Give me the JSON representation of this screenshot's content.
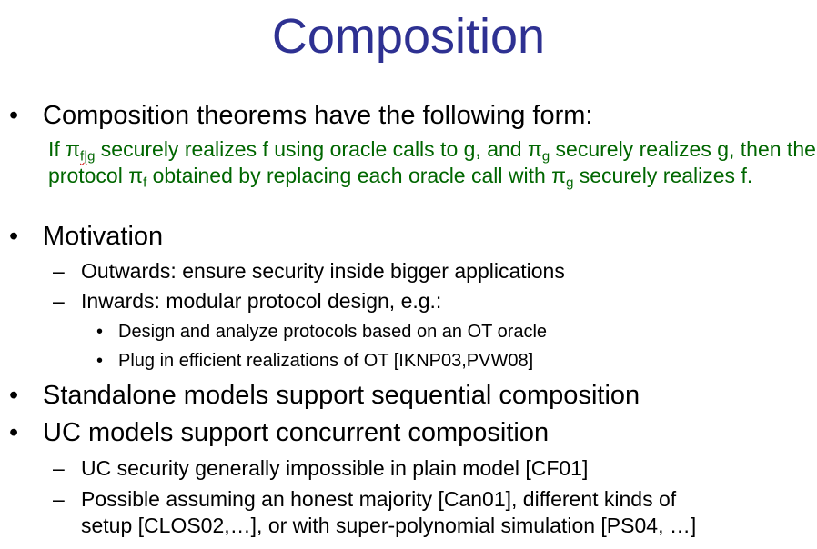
{
  "title": "Composition",
  "bullet1": "Composition theorems have the following form:",
  "theorem": {
    "p1": "If π",
    "s1": "f|g",
    "p2": " securely realizes f using oracle calls to g, and π",
    "s2": "g",
    "p3": " securely realizes g, then the protocol π",
    "s3": "f",
    "p4": " obtained by replacing each oracle call with π",
    "s4": "g",
    "p5": " securely realizes f."
  },
  "bullet2": "Motivation",
  "sub2": {
    "outwards": "Outwards: ensure security inside bigger applications",
    "inwards": "Inwards: modular protocol design, e.g.:",
    "design": "Design and analyze protocols based on an OT oracle",
    "plug": "Plug in efficient realizations of OT [IKNP03,PVW08]"
  },
  "bullet3": "Standalone models support sequential composition",
  "bullet4": "UC models support concurrent composition",
  "sub4": {
    "uc": "UC security generally impossible in plain model [CF01]",
    "possible_l1": "Possible assuming an honest majority [Can01], different kinds of",
    "possible_l2": "setup [CLOS02,…], or with super-polynomial simulation [PS04, …]"
  },
  "markers": {
    "bullet": "•",
    "dash": "–"
  }
}
